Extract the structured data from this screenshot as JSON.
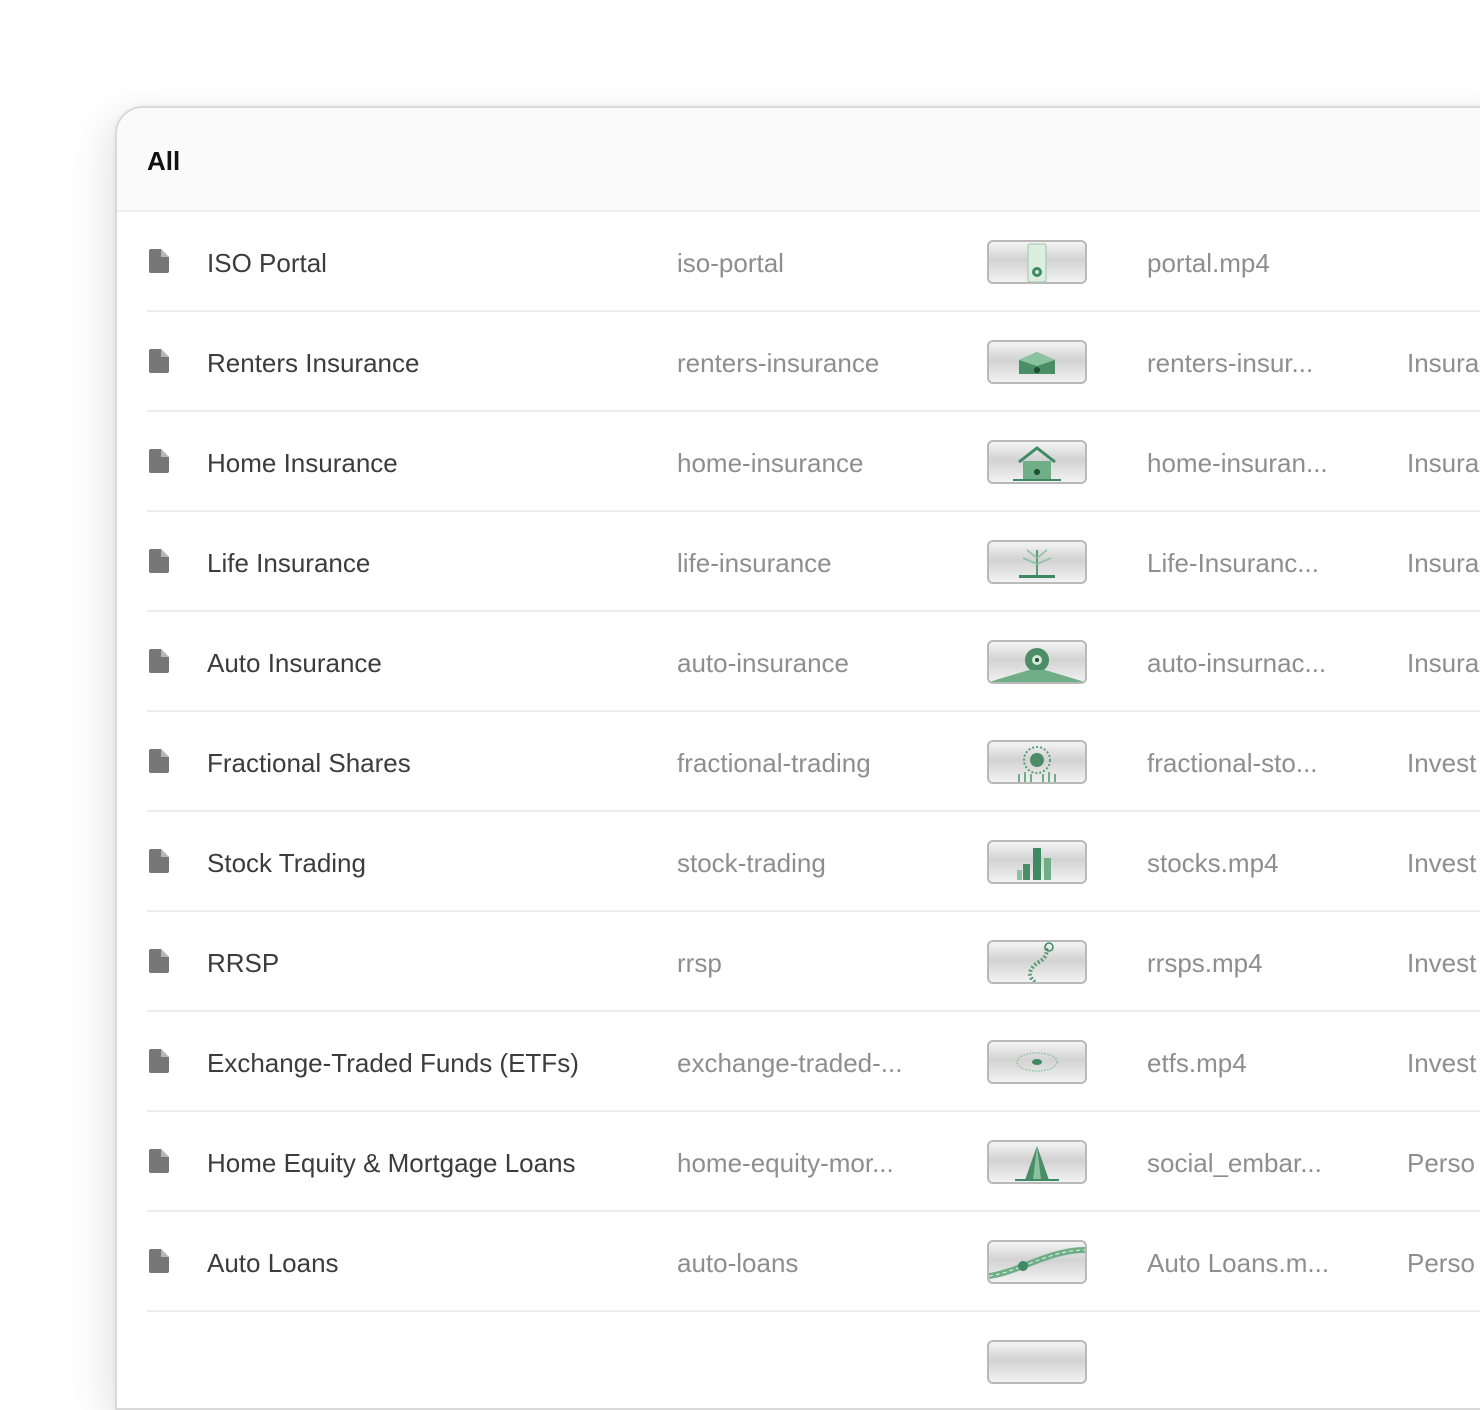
{
  "header": {
    "title": "All"
  },
  "rows": [
    {
      "name": "ISO Portal",
      "slug": "iso-portal",
      "thumb_icon": "portal-thumbnail",
      "file": "portal.mp4",
      "category": ""
    },
    {
      "name": "Renters Insurance",
      "slug": "renters-insurance",
      "thumb_icon": "box-thumbnail",
      "file": "renters-insur...",
      "category": "Insura"
    },
    {
      "name": "Home Insurance",
      "slug": "home-insurance",
      "thumb_icon": "house-thumbnail",
      "file": "home-insuran...",
      "category": "Insura"
    },
    {
      "name": "Life Insurance",
      "slug": "life-insurance",
      "thumb_icon": "tree-thumbnail",
      "file": "Life-Insuranc...",
      "category": "Insura"
    },
    {
      "name": "Auto Insurance",
      "slug": "auto-insurance",
      "thumb_icon": "wheel-thumbnail",
      "file": "auto-insurnac...",
      "category": "Insura"
    },
    {
      "name": "Fractional Shares",
      "slug": "fractional-trading",
      "thumb_icon": "pie-thumbnail",
      "file": "fractional-sto...",
      "category": "Invest"
    },
    {
      "name": "Stock Trading",
      "slug": "stock-trading",
      "thumb_icon": "bars-thumbnail",
      "file": "stocks.mp4",
      "category": "Invest"
    },
    {
      "name": "RRSP",
      "slug": "rrsp",
      "thumb_icon": "stairs-thumbnail",
      "file": "rrsps.mp4",
      "category": "Invest"
    },
    {
      "name": "Exchange-Traded Funds (ETFs)",
      "slug": "exchange-traded-...",
      "thumb_icon": "disc-thumbnail",
      "file": "etfs.mp4",
      "category": "Invest"
    },
    {
      "name": "Home Equity & Mortgage Loans",
      "slug": "home-equity-mor...",
      "thumb_icon": "tower-thumbnail",
      "file": "social_embar...",
      "category": "Perso"
    },
    {
      "name": "Auto Loans",
      "slug": "auto-loans",
      "thumb_icon": "road-thumbnail",
      "file": "Auto Loans.m...",
      "category": "Perso"
    },
    {
      "name": "",
      "slug": "",
      "thumb_icon": "partial-thumbnail",
      "file": "",
      "category": ""
    }
  ],
  "colors": {
    "accent": "#3e8a63",
    "text": "#3c3c3c",
    "muted": "#8e8e8e",
    "icon": "#777777"
  }
}
